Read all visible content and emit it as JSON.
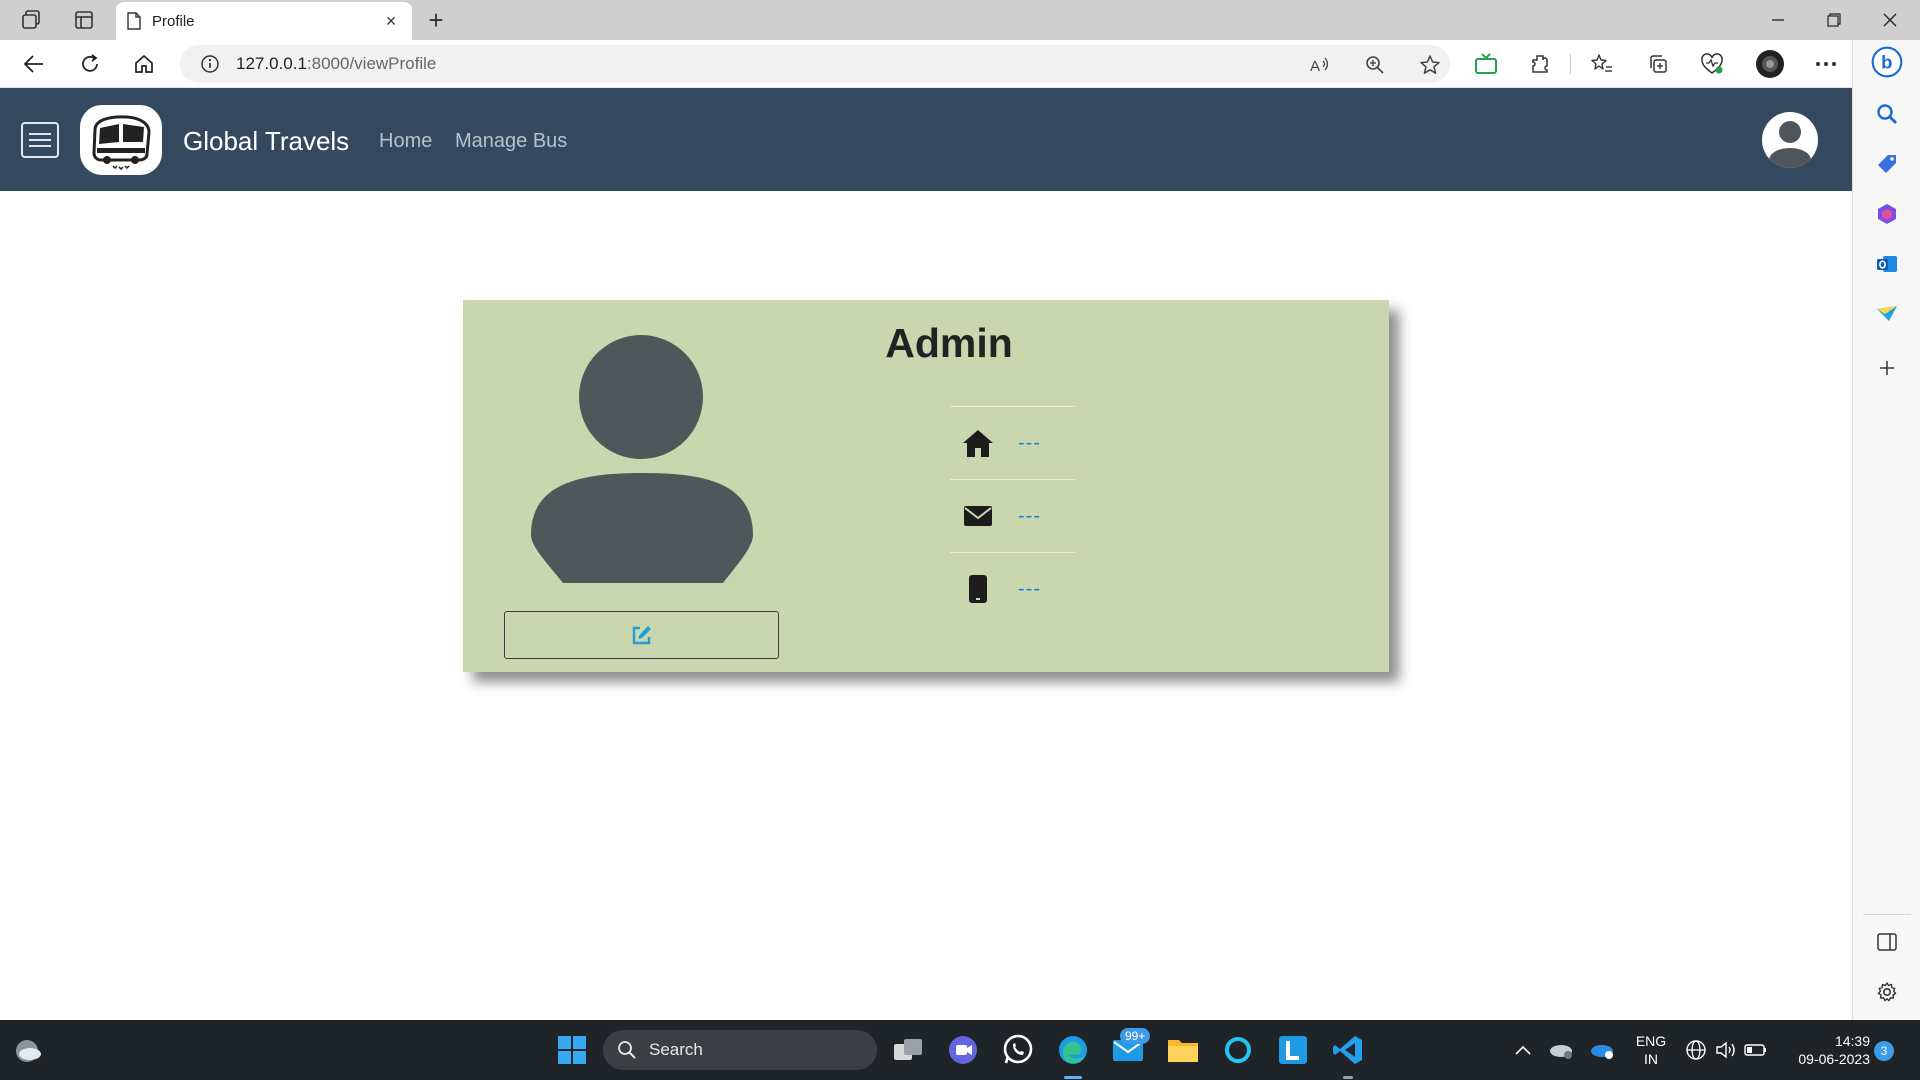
{
  "browser": {
    "tab_title": "Profile",
    "tab_close": "×",
    "new_tab": "+",
    "url_host": "127.0.0.1",
    "url_path": ":8000/viewProfile",
    "read_aloud_icon": "read-aloud-icon"
  },
  "site": {
    "brand": "Global Travels",
    "nav": [
      "Home",
      "Manage Bus"
    ]
  },
  "profile": {
    "name": "Admin",
    "address": "---",
    "email": "---",
    "phone": "---"
  },
  "taskbar": {
    "search_label": "Search",
    "mail_badge": "99+",
    "lang_top": "ENG",
    "lang_bottom": "IN",
    "time": "14:39",
    "date": "09-06-2023",
    "notifications": "3"
  },
  "colors": {
    "navbar": "#34495e",
    "card": "#c9d6ae",
    "link_value": "#1e7be0",
    "edit_icon": "#1a9fd8"
  }
}
